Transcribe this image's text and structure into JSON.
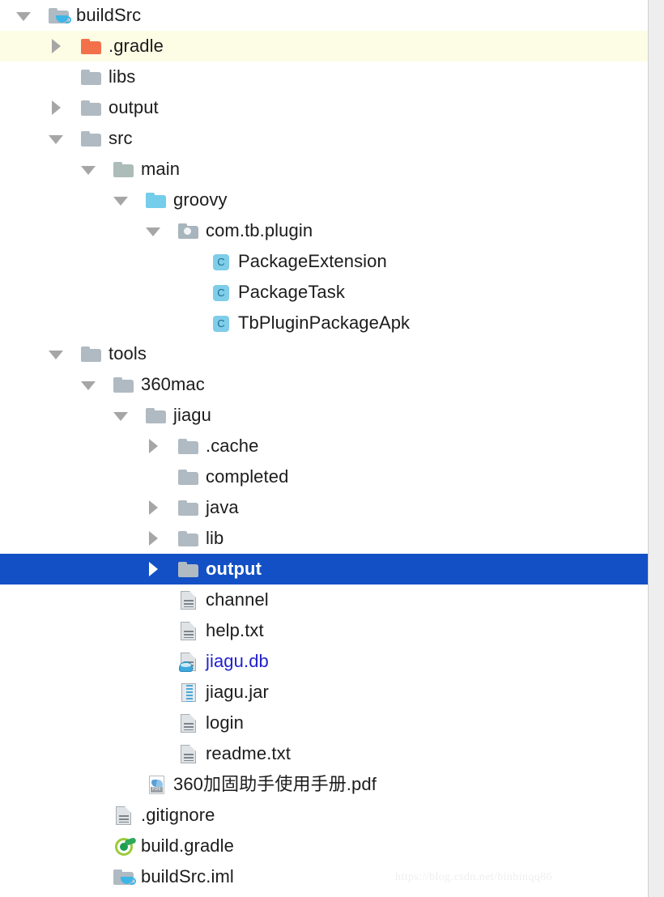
{
  "watermark": "https://blog.csdn.net/binbinqq86",
  "colors": {
    "selection_blue": "#1350c5",
    "hover_yellow": "#fdfde6",
    "text": "#1c1c1c",
    "link_blue": "#2222cc",
    "folder_gray": "#b0bac2",
    "folder_blue": "#74cdeb",
    "folder_orange": "#f2714a",
    "gradle_green": "#1f9e52"
  },
  "tree": {
    "rows": [
      {
        "label": "buildSrc",
        "icon": "module-folder-icon",
        "indent": 0,
        "toggle": "expanded",
        "highlight": "none"
      },
      {
        "label": ".gradle",
        "icon": "folder-orange-icon",
        "indent": 1,
        "toggle": "collapsed",
        "highlight": "yellow"
      },
      {
        "label": "libs",
        "icon": "folder-gray-icon",
        "indent": 1,
        "toggle": "none",
        "highlight": "none"
      },
      {
        "label": "output",
        "icon": "folder-gray-icon",
        "indent": 1,
        "toggle": "collapsed",
        "highlight": "none"
      },
      {
        "label": "src",
        "icon": "folder-gray-icon",
        "indent": 1,
        "toggle": "expanded",
        "highlight": "none"
      },
      {
        "label": "main",
        "icon": "folder-sage-icon",
        "indent": 2,
        "toggle": "expanded",
        "highlight": "none"
      },
      {
        "label": "groovy",
        "icon": "folder-source-icon",
        "indent": 3,
        "toggle": "expanded",
        "highlight": "none"
      },
      {
        "label": "com.tb.plugin",
        "icon": "package-folder-icon",
        "indent": 4,
        "toggle": "expanded",
        "highlight": "none"
      },
      {
        "label": "PackageExtension",
        "icon": "class-icon",
        "indent": 5,
        "toggle": "none",
        "highlight": "none"
      },
      {
        "label": "PackageTask",
        "icon": "class-icon",
        "indent": 5,
        "toggle": "none",
        "highlight": "none"
      },
      {
        "label": "TbPluginPackageApk",
        "icon": "class-icon",
        "indent": 5,
        "toggle": "none",
        "highlight": "none"
      },
      {
        "label": "tools",
        "icon": "folder-gray-icon",
        "indent": 1,
        "toggle": "expanded",
        "highlight": "none"
      },
      {
        "label": "360mac",
        "icon": "folder-gray-icon",
        "indent": 2,
        "toggle": "expanded",
        "highlight": "none"
      },
      {
        "label": "jiagu",
        "icon": "folder-gray-icon",
        "indent": 3,
        "toggle": "expanded",
        "highlight": "none"
      },
      {
        "label": ".cache",
        "icon": "folder-gray-icon",
        "indent": 4,
        "toggle": "collapsed",
        "highlight": "none"
      },
      {
        "label": "completed",
        "icon": "folder-gray-icon",
        "indent": 4,
        "toggle": "none",
        "highlight": "none"
      },
      {
        "label": "java",
        "icon": "folder-gray-icon",
        "indent": 4,
        "toggle": "collapsed",
        "highlight": "none"
      },
      {
        "label": "lib",
        "icon": "folder-gray-icon",
        "indent": 4,
        "toggle": "collapsed",
        "highlight": "none"
      },
      {
        "label": "output",
        "icon": "folder-gray-icon",
        "indent": 4,
        "toggle": "collapsed",
        "highlight": "blue"
      },
      {
        "label": "channel",
        "icon": "file-text-icon",
        "indent": 4,
        "toggle": "none",
        "highlight": "none"
      },
      {
        "label": "help.txt",
        "icon": "file-text-icon",
        "indent": 4,
        "toggle": "none",
        "highlight": "none"
      },
      {
        "label": "jiagu.db",
        "icon": "file-db-icon",
        "indent": 4,
        "toggle": "none",
        "highlight": "none",
        "link": true
      },
      {
        "label": "jiagu.jar",
        "icon": "file-jar-icon",
        "indent": 4,
        "toggle": "none",
        "highlight": "none"
      },
      {
        "label": "login",
        "icon": "file-text-icon",
        "indent": 4,
        "toggle": "none",
        "highlight": "none"
      },
      {
        "label": "readme.txt",
        "icon": "file-text-icon",
        "indent": 4,
        "toggle": "none",
        "highlight": "none"
      },
      {
        "label": "360加固助手使用手册.pdf",
        "icon": "file-pdf-icon",
        "indent": 3,
        "toggle": "none",
        "highlight": "none"
      },
      {
        "label": ".gitignore",
        "icon": "file-text-icon",
        "indent": 2,
        "toggle": "none",
        "highlight": "none"
      },
      {
        "label": "build.gradle",
        "icon": "gradle-icon",
        "indent": 2,
        "toggle": "none",
        "highlight": "none"
      },
      {
        "label": "buildSrc.iml",
        "icon": "module-folder-icon",
        "indent": 2,
        "toggle": "none",
        "highlight": "none"
      }
    ]
  }
}
